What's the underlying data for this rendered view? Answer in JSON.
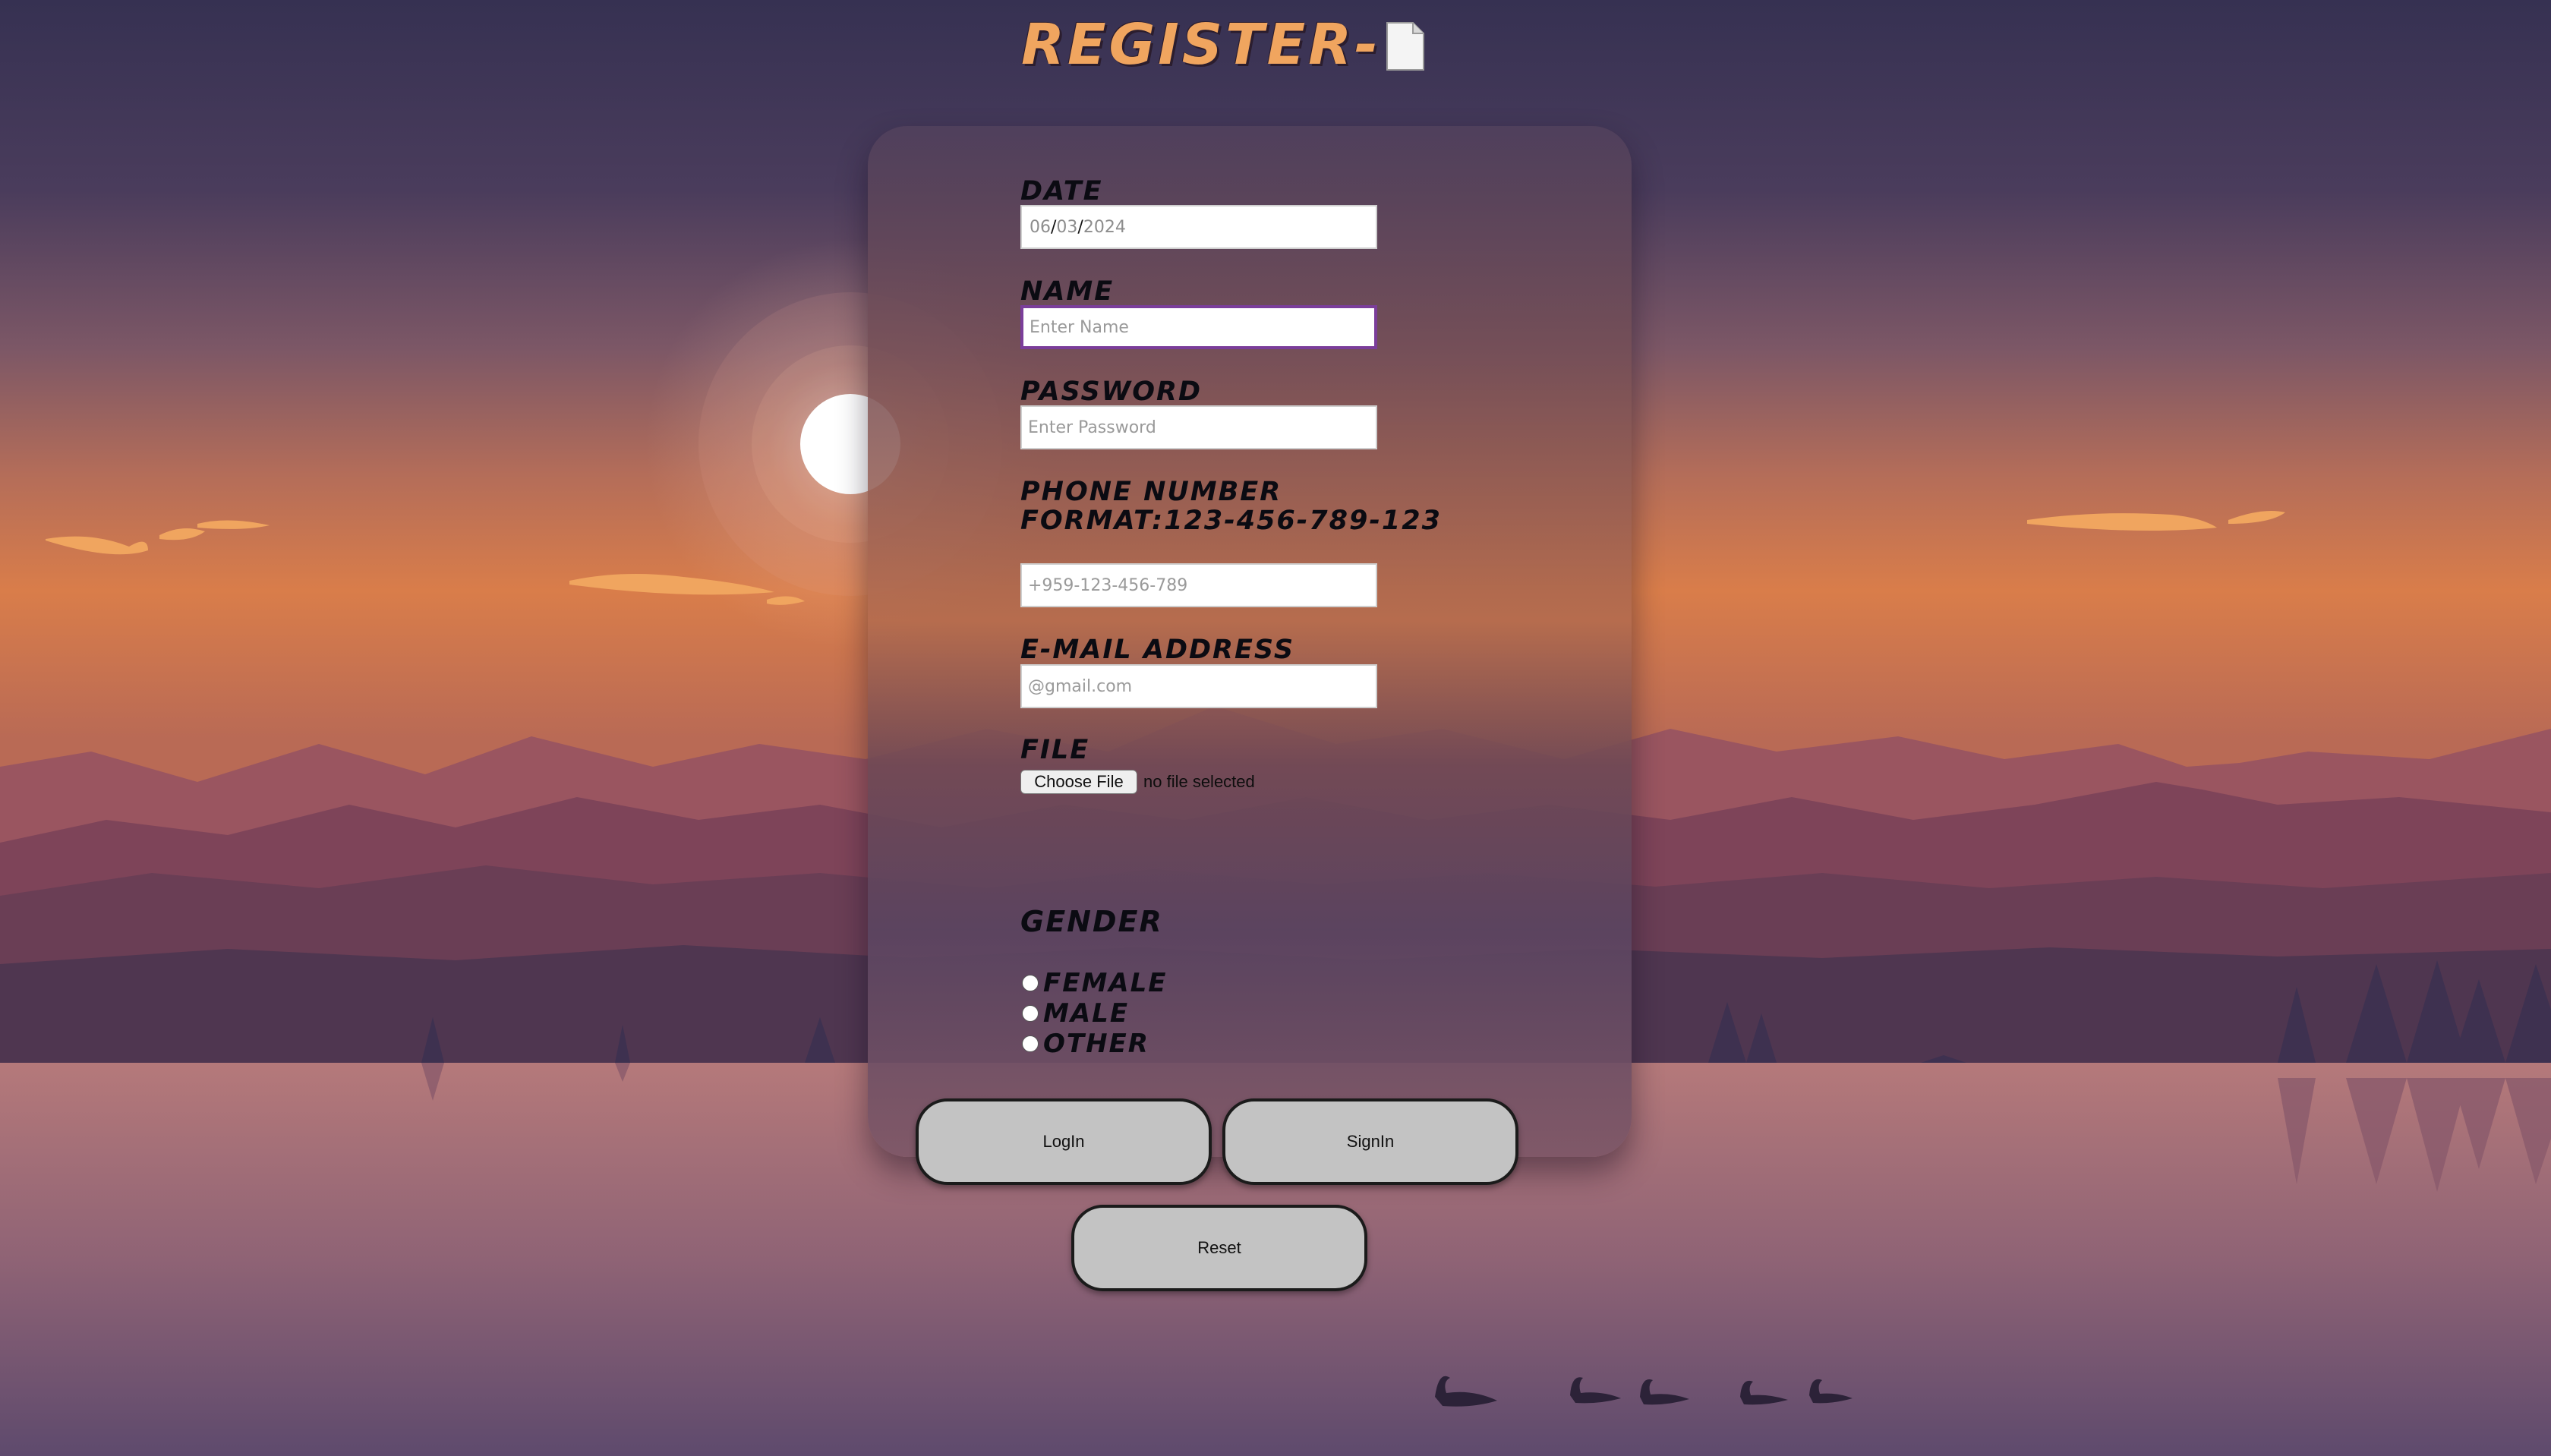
{
  "page": {
    "title": "REGISTER-"
  },
  "form": {
    "date": {
      "label": "Date",
      "day": "06",
      "month": "03",
      "year": "2024",
      "separator": "/"
    },
    "name": {
      "label": "Name",
      "placeholder": "Enter Name"
    },
    "password": {
      "label": "Password",
      "placeholder": "Enter Password"
    },
    "phone": {
      "label_line1": "Phone Number",
      "label_line2": "Format:123-456-789-123",
      "placeholder": "+959-123-456-789"
    },
    "email": {
      "label": "E-mail Address",
      "placeholder": "@gmail.com"
    },
    "file": {
      "label": "File",
      "button_label": "Choose File",
      "status": "no file selected"
    },
    "gender": {
      "label": "Gender",
      "options": [
        "Female",
        "Male",
        "Other"
      ]
    }
  },
  "buttons": {
    "login": "LogIn",
    "signin": "SignIn",
    "reset": "Reset"
  },
  "colors": {
    "title_orange": "#f0a55f",
    "sky_top": "#3a3455",
    "horizon_orange": "#d5774b",
    "mountain_mid": "#7a4558",
    "water": "#a86f78",
    "focus_border": "#7b3e9a",
    "button_bg": "#c3c3c3"
  },
  "icons": {
    "title_icon": "document-icon"
  }
}
